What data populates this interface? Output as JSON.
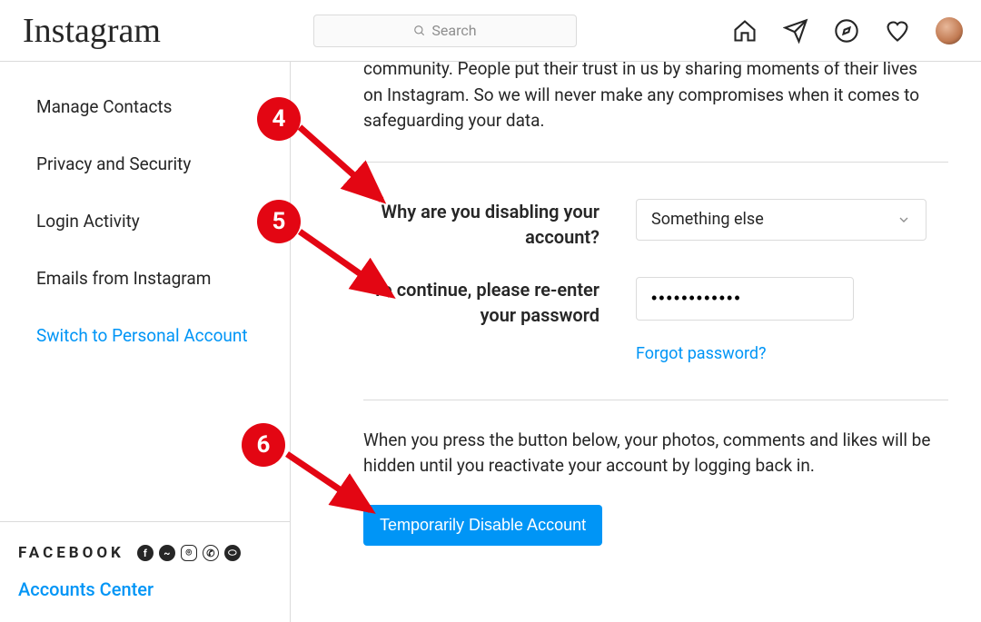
{
  "brand": "Instagram",
  "search": {
    "placeholder": "Search"
  },
  "sidebar": {
    "items": [
      {
        "label": "Manage Contacts"
      },
      {
        "label": "Privacy and Security"
      },
      {
        "label": "Login Activity"
      },
      {
        "label": "Emails from Instagram"
      },
      {
        "label": "Switch to Personal Account",
        "link": true
      }
    ]
  },
  "fb": {
    "logo": "FACEBOOK",
    "accounts_center": "Accounts Center"
  },
  "main": {
    "intro": "community. People put their trust in us by sharing moments of their lives on Instagram. So we will never make any compromises when it comes to safeguarding your data.",
    "reason_label": "Why are you disabling your account?",
    "reason_value": "Something else",
    "password_label": "To continue, please re-enter your password",
    "password_value": "••••••••••••",
    "forgot": "Forgot password?",
    "notice": "When you press the button below, your photos, comments and likes will be hidden until you reactivate your account by logging back in.",
    "disable_button": "Temporarily Disable Account"
  },
  "annotations": {
    "m4": "4",
    "m5": "5",
    "m6": "6"
  }
}
